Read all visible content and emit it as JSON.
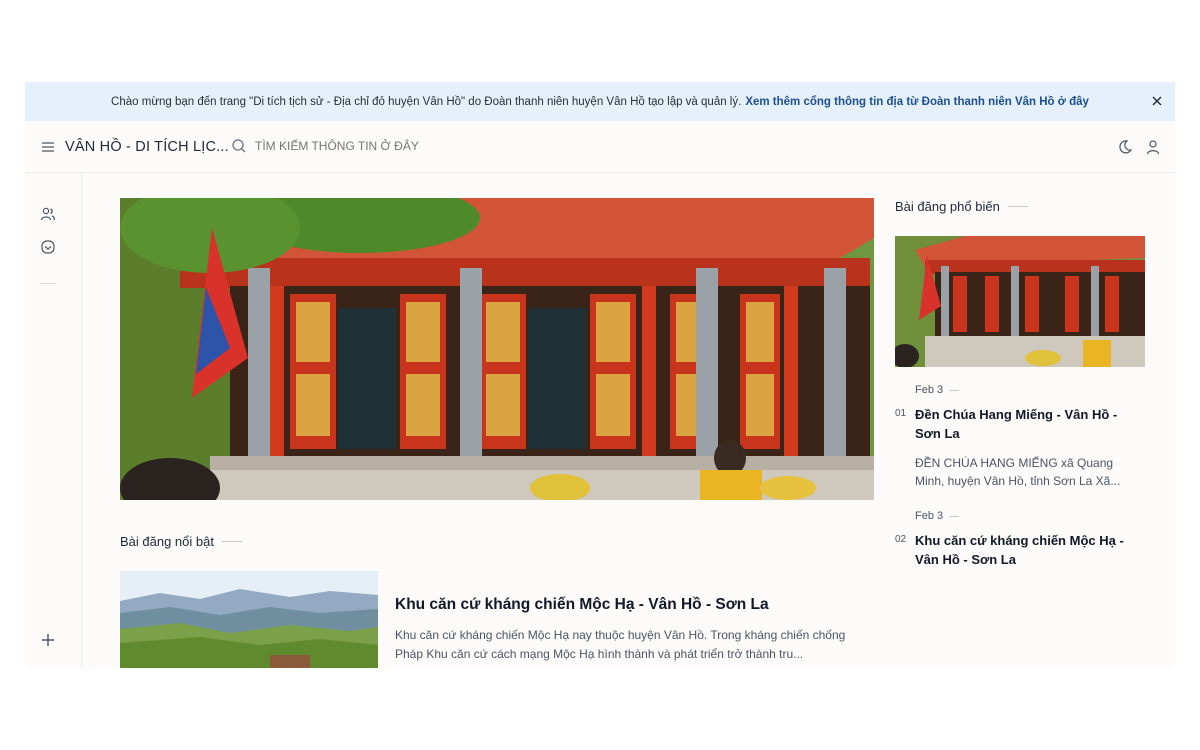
{
  "notice": {
    "text": "Chào mừng bạn đến trang \"Di tích tịch sử - Địa chỉ đỏ huyện Vân Hồ\" do Đoàn thanh niên huyện Vân Hồ tạo lập và quản lý.",
    "link": "Xem thêm cổng thông tin địa từ Đoàn thanh niên Vân Hồ ở đây",
    "close_icon": "close-icon"
  },
  "header": {
    "site_title": "VÂN HỒ - DI TÍCH LỊC...",
    "search_placeholder": "TÌM KIẾM THÔNG TIN Ở ĐÂY",
    "icons": [
      "menu-icon",
      "search-icon",
      "moon-icon",
      "user-icon"
    ]
  },
  "sidebar": {
    "icons": [
      "users-icon",
      "inbox-icon",
      "plus-icon"
    ]
  },
  "featured": {
    "section_title": "Bài đăng nổi bật",
    "title": "Khu căn cứ kháng chiến Mộc Hạ - Vân Hồ - Sơn La",
    "excerpt": "Khu căn cứ kháng chiến Mộc Hạ nay thuộc huyện Vân Hồ. Trong kháng chiến chống Pháp Khu căn cứ cách mạng Mộc Hạ hình thành và phát triển trở thành tru..."
  },
  "popular": {
    "section_title": "Bài đăng phổ biến",
    "posts": [
      {
        "date": "Feb 3",
        "num": "01",
        "title": "Đền Chúa Hang Miếng - Vân Hồ - Sơn La",
        "excerpt": "ĐỀN CHÚA HANG MIẾNG xã Quang Minh, huyện Vân Hồ, tỉnh Sơn La Xã..."
      },
      {
        "date": "Feb 3",
        "num": "02",
        "title": "Khu căn cứ kháng chiến Mộc Hạ - Vân Hồ - Sơn La",
        "excerpt": ""
      }
    ]
  },
  "colors": {
    "notice_bg": "#e6f0fa",
    "link": "#1d4f91",
    "temple_red": "#c8341c",
    "roof": "#d2553a"
  }
}
